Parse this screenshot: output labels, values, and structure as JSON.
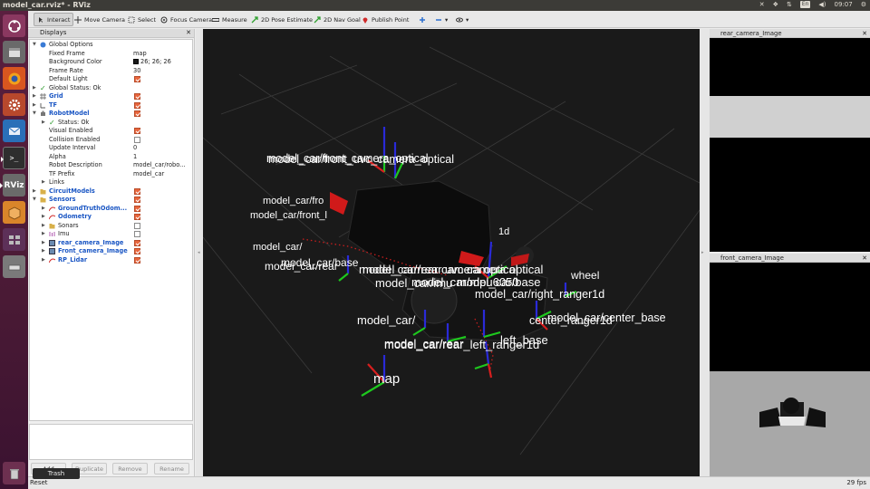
{
  "window_title": "model_car.rviz* - RViz",
  "tray": {
    "keyboard": "En",
    "time": "09:07"
  },
  "toolbar": {
    "interact": "Interact",
    "move_camera": "Move Camera",
    "select": "Select",
    "focus_camera": "Focus Camera",
    "measure": "Measure",
    "pose_estimate": "2D Pose Estimate",
    "nav_goal": "2D Nav Goal",
    "publish_point": "Publish Point"
  },
  "displays": {
    "title": "Displays",
    "rows": [
      {
        "label": "Global Options"
      },
      {
        "label": "Fixed Frame",
        "value": "map"
      },
      {
        "label": "Background Color",
        "value": "26; 26; 26"
      },
      {
        "label": "Frame Rate",
        "value": "30"
      },
      {
        "label": "Default Light"
      },
      {
        "label": "Global Status: Ok"
      },
      {
        "label": "Grid"
      },
      {
        "label": "TF"
      },
      {
        "label": "RobotModel"
      },
      {
        "label": "Status: Ok"
      },
      {
        "label": "Visual Enabled"
      },
      {
        "label": "Collision Enabled"
      },
      {
        "label": "Update Interval",
        "value": "0"
      },
      {
        "label": "Alpha",
        "value": "1"
      },
      {
        "label": "Robot Description",
        "value": "model_car/robo..."
      },
      {
        "label": "TF Prefix",
        "value": "model_car"
      },
      {
        "label": "Links"
      },
      {
        "label": "CircuitModels"
      },
      {
        "label": "Sensors"
      },
      {
        "label": "GroundTruthOdom..."
      },
      {
        "label": "Odometry"
      },
      {
        "label": "Sonars"
      },
      {
        "label": "Imu"
      },
      {
        "label": "rear_camera_Image"
      },
      {
        "label": "Front_camera_Image"
      },
      {
        "label": "RP_Lidar"
      }
    ],
    "buttons": {
      "add": "Add",
      "duplicate": "Duplicate",
      "remove": "Remove",
      "rename": "Rename"
    }
  },
  "tooltip": "Trash",
  "view3d": {
    "frame_labels": [
      "model_car/front_camera_optical",
      "model_car/front_uvc_camera_optical",
      "model_car/fro",
      "model_car/front_l",
      "model_car/",
      "1d",
      "model_car/rear",
      "model_car/base",
      "model_car/rear camera optical",
      "model_car/rear uvc camera optical",
      "model_car/imu",
      "model_car/mpu6050",
      "model_car/base",
      "wheel",
      "model_car/right_ranger1d",
      "model_car/center_base",
      "model_car/",
      "center_ranger1d",
      "model_car/rear",
      "left_base",
      "model_car/rear_left_ranger1d",
      "map"
    ]
  },
  "rear_camera": {
    "title": "rear_camera_Image"
  },
  "front_camera": {
    "title": "front_camera_Image"
  },
  "status": {
    "reset": "Reset",
    "fps": "29 fps"
  }
}
